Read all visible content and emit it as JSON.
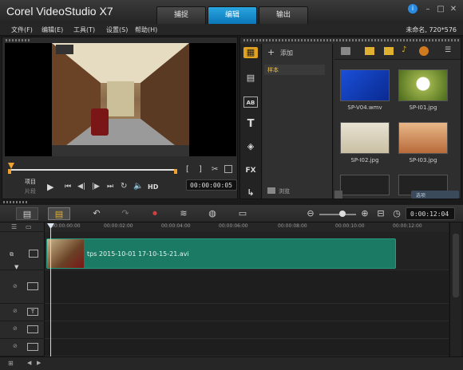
{
  "app": {
    "title": "Corel VideoStudio X7",
    "project_info": "未命名, 720*576"
  },
  "tabs": [
    "捕捉",
    "编辑",
    "输出"
  ],
  "menu": [
    "文件(F)",
    "编辑(E)",
    "工具(T)",
    "设置(S)",
    "帮助(H)"
  ],
  "player": {
    "mode_project": "项目",
    "mode_clip": "片段",
    "hd_label": "HD",
    "timecode": "00:00:00:05",
    "mark_in": "[",
    "mark_out": "]"
  },
  "library": {
    "add_label": "添加",
    "folder_label": "样本",
    "browse_label": "浏览",
    "options_label": "选项",
    "thumbnails": [
      "SP-V04.wmv",
      "SP-I01.jpg",
      "SP-I02.jpg",
      "SP-I03.jpg"
    ]
  },
  "timeline": {
    "timecode": "0:00:12:04",
    "ruler_labels": [
      "00:00:00:00",
      "00:00:02:00",
      "00:00:04:00",
      "00:00:06:00",
      "00:00:08:00",
      "00:00:10:00",
      "00:00:12:00"
    ],
    "clip_name": "tps 2015-10-01 17-10-15-21.avi"
  },
  "colors": {
    "accent": "#1493d6",
    "clip": "#1b7a64",
    "scrubber": "#f0a030",
    "active_folder": "#f0c040"
  },
  "icons": [
    "help-icon",
    "minimize-icon",
    "maximize-icon",
    "close-icon",
    "play-icon",
    "home-icon",
    "prev-frame-icon",
    "next-frame-icon",
    "end-icon",
    "repeat-icon",
    "volume-icon",
    "cut-icon",
    "enlarge-icon",
    "media-icon",
    "instant-project-icon",
    "transition-icon",
    "title-icon",
    "graphics-icon",
    "filter-icon",
    "path-icon",
    "undo-icon",
    "redo-icon",
    "record-icon",
    "audio-mix-icon",
    "zoom-out-icon",
    "zoom-in-icon",
    "fit-icon"
  ]
}
